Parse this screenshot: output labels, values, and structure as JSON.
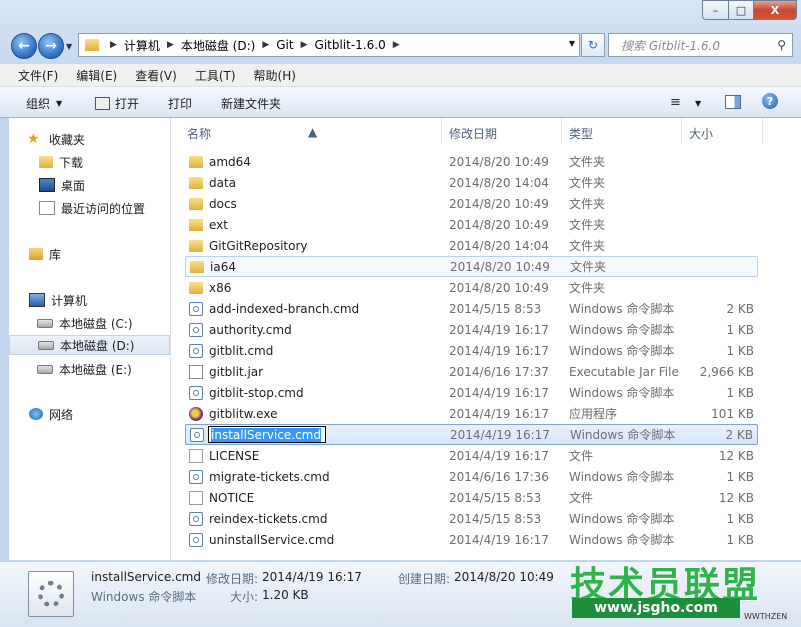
{
  "window": {
    "minimize": "–",
    "maximize": "□",
    "close": "X"
  },
  "address": {
    "crumbs": [
      "计算机",
      "本地磁盘 (D:)",
      "Git",
      "Gitblit-1.6.0"
    ],
    "search_placeholder": "搜索 Gitblit-1.6.0"
  },
  "menu": [
    "文件(F)",
    "编辑(E)",
    "查看(V)",
    "工具(T)",
    "帮助(H)"
  ],
  "toolbar": {
    "organize": "组织",
    "open": "打开",
    "print": "打印",
    "new_folder": "新建文件夹"
  },
  "nav": {
    "favorites": "收藏夹",
    "downloads": "下载",
    "desktop": "桌面",
    "recent": "最近访问的位置",
    "libraries": "库",
    "computer": "计算机",
    "disk_c": "本地磁盘 (C:)",
    "disk_d": "本地磁盘 (D:)",
    "disk_e": "本地磁盘 (E:)",
    "network": "网络"
  },
  "columns": {
    "name": "名称",
    "modified": "修改日期",
    "type": "类型",
    "size": "大小"
  },
  "files": [
    {
      "name": "amd64",
      "date": "2014/8/20 10:49",
      "type": "文件夹",
      "size": "",
      "icon": "folder"
    },
    {
      "name": "data",
      "date": "2014/8/20 14:04",
      "type": "文件夹",
      "size": "",
      "icon": "folder"
    },
    {
      "name": "docs",
      "date": "2014/8/20 10:49",
      "type": "文件夹",
      "size": "",
      "icon": "folder"
    },
    {
      "name": "ext",
      "date": "2014/8/20 10:49",
      "type": "文件夹",
      "size": "",
      "icon": "folder"
    },
    {
      "name": "GitGitRepository",
      "date": "2014/8/20 14:04",
      "type": "文件夹",
      "size": "",
      "icon": "folder"
    },
    {
      "name": "ia64",
      "date": "2014/8/20 10:49",
      "type": "文件夹",
      "size": "",
      "icon": "folder"
    },
    {
      "name": "x86",
      "date": "2014/8/20 10:49",
      "type": "文件夹",
      "size": "",
      "icon": "folder"
    },
    {
      "name": "add-indexed-branch.cmd",
      "date": "2014/5/15 8:53",
      "type": "Windows 命令脚本",
      "size": "2 KB",
      "icon": "cmd"
    },
    {
      "name": "authority.cmd",
      "date": "2014/4/19 16:17",
      "type": "Windows 命令脚本",
      "size": "1 KB",
      "icon": "cmd"
    },
    {
      "name": "gitblit.cmd",
      "date": "2014/4/19 16:17",
      "type": "Windows 命令脚本",
      "size": "1 KB",
      "icon": "cmd"
    },
    {
      "name": "gitblit.jar",
      "date": "2014/6/16 17:37",
      "type": "Executable Jar File",
      "size": "2,966 KB",
      "icon": "jar"
    },
    {
      "name": "gitblit-stop.cmd",
      "date": "2014/4/19 16:17",
      "type": "Windows 命令脚本",
      "size": "1 KB",
      "icon": "cmd"
    },
    {
      "name": "gitblitw.exe",
      "date": "2014/4/19 16:17",
      "type": "应用程序",
      "size": "101 KB",
      "icon": "exe"
    },
    {
      "name": "installService.cmd",
      "date": "2014/4/19 16:17",
      "type": "Windows 命令脚本",
      "size": "2 KB",
      "icon": "cmd"
    },
    {
      "name": "LICENSE",
      "date": "2014/4/19 16:17",
      "type": "文件",
      "size": "12 KB",
      "icon": "doc"
    },
    {
      "name": "migrate-tickets.cmd",
      "date": "2014/6/16 17:36",
      "type": "Windows 命令脚本",
      "size": "1 KB",
      "icon": "cmd"
    },
    {
      "name": "NOTICE",
      "date": "2014/5/15 8:53",
      "type": "文件",
      "size": "12 KB",
      "icon": "doc"
    },
    {
      "name": "reindex-tickets.cmd",
      "date": "2014/5/15 8:53",
      "type": "Windows 命令脚本",
      "size": "1 KB",
      "icon": "cmd"
    },
    {
      "name": "uninstallService.cmd",
      "date": "2014/4/19 16:17",
      "type": "Windows 命令脚本",
      "size": "1 KB",
      "icon": "cmd"
    }
  ],
  "details": {
    "name": "installService.cmd",
    "type": "Windows 命令脚本",
    "modified_label": "修改日期:",
    "modified": "2014/4/19 16:17",
    "size_label": "大小:",
    "size": "1.20 KB",
    "created_label": "创建日期:",
    "created": "2014/8/20 10:49"
  },
  "watermark": {
    "title": "技术员联盟",
    "url": "www.jsgho.com",
    "small": "WWTHZEN"
  }
}
